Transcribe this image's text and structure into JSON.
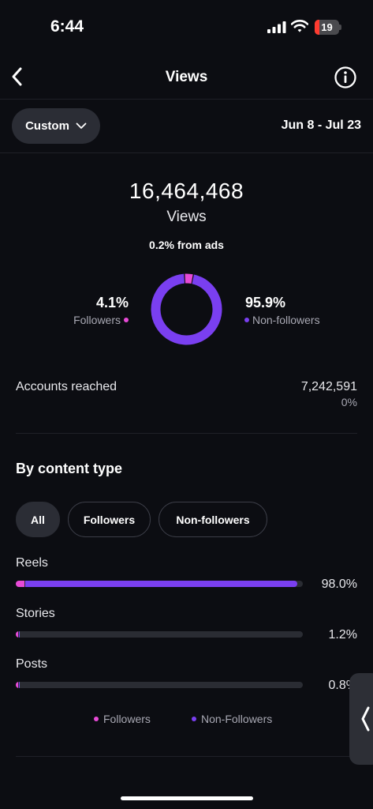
{
  "status_bar": {
    "time": "6:44",
    "battery_level": "19",
    "battery_fraction": 0.19,
    "battery_color": "#ff3b30"
  },
  "header": {
    "title": "Views",
    "back_icon": "chevron-left-icon",
    "info_icon": "info-circle-icon"
  },
  "filters": {
    "range_label": "Custom",
    "range_icon": "chevron-down-icon",
    "date_range": "Jun 8 - Jul 23"
  },
  "summary": {
    "total_views": "16,464,468",
    "views_label": "Views",
    "ads_text": "0.2% from ads",
    "followers_percent": "4.1%",
    "followers_label": "Followers",
    "non_followers_percent": "95.9%",
    "non_followers_label": "Non-followers"
  },
  "accounts": {
    "label": "Accounts reached",
    "value": "7,242,591",
    "change": "0%"
  },
  "content_type": {
    "title": "By content type",
    "tabs": [
      {
        "label": "All",
        "active": true
      },
      {
        "label": "Followers",
        "active": false
      },
      {
        "label": "Non-followers",
        "active": false
      }
    ],
    "rows": [
      {
        "label": "Reels",
        "value": "98.0%",
        "fraction": 0.98,
        "follower_fraction": 0.03
      },
      {
        "label": "Stories",
        "value": "1.2%",
        "fraction": 0.012,
        "follower_fraction": 0.006
      },
      {
        "label": "Posts",
        "value": "0.8%",
        "fraction": 0.008,
        "follower_fraction": 0.004
      }
    ],
    "legend": {
      "followers": "Followers",
      "non_followers": "Non-Followers"
    }
  },
  "chart_data": {
    "type": "pie",
    "categories": [
      "Followers",
      "Non-followers"
    ],
    "values": [
      4.1,
      95.9
    ]
  },
  "colors": {
    "background": "#0c0d12",
    "followers": "#e84ad6",
    "non_followers": "#7a3ff0",
    "track": "#2a2c33"
  }
}
